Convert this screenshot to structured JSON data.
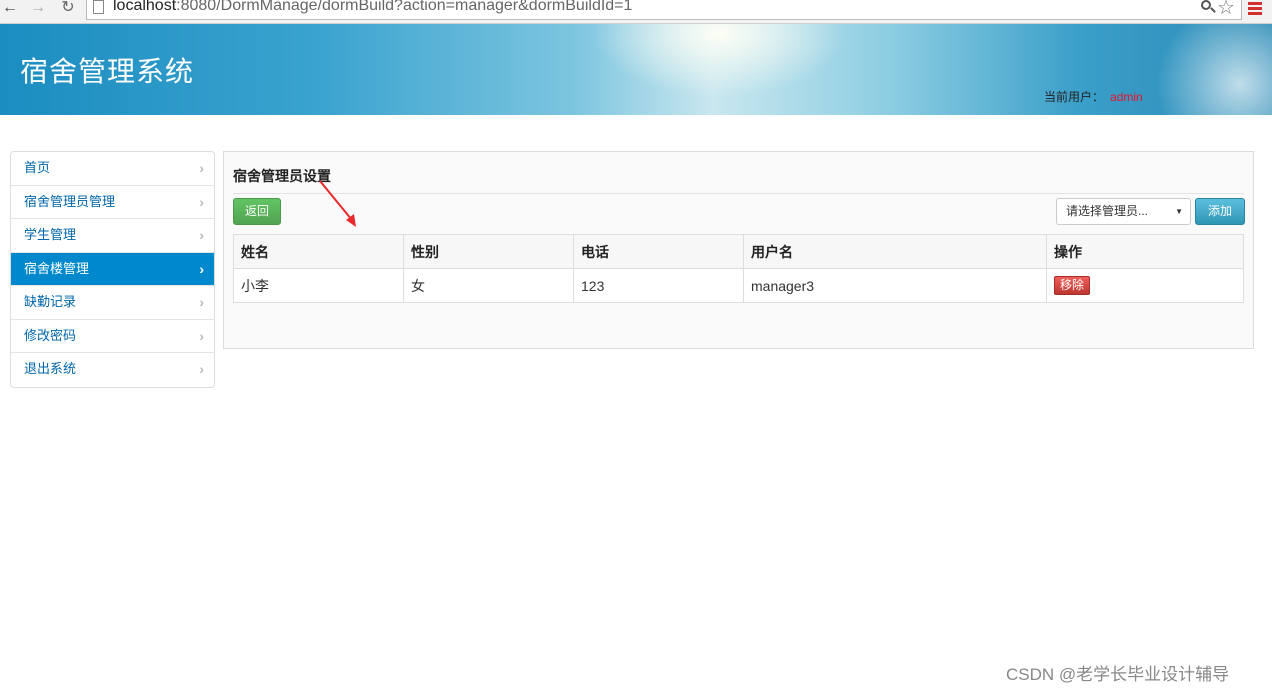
{
  "browser": {
    "url_host": "localhost",
    "url_rest": ":8080/DormManage/dormBuild?action=manager&dormBuildId=1"
  },
  "header": {
    "title": "宿舍管理系统",
    "user_label": "当前用户：",
    "user_name": "admin"
  },
  "sidebar": {
    "items": [
      {
        "label": "首页"
      },
      {
        "label": "宿舍管理员管理"
      },
      {
        "label": "学生管理"
      },
      {
        "label": "宿舍楼管理",
        "active": true
      },
      {
        "label": "缺勤记录"
      },
      {
        "label": "修改密码"
      },
      {
        "label": "退出系统"
      }
    ]
  },
  "main": {
    "title": "宿舍管理员设置",
    "back_label": "返回",
    "select_placeholder": "请选择管理员...",
    "add_label": "添加",
    "table": {
      "headers": [
        "姓名",
        "性别",
        "电话",
        "用户名",
        "操作"
      ],
      "rows": [
        {
          "name": "小李",
          "gender": "女",
          "phone": "123",
          "username": "manager3",
          "action": "移除"
        }
      ]
    }
  },
  "colors": {
    "accent": "#0088cc",
    "success": "#5cb85c",
    "info": "#49afcd",
    "danger": "#da4f49",
    "user_name": "#e8132b"
  },
  "icons": [
    "back-arrow-icon",
    "forward-arrow-icon",
    "reload-icon",
    "page-icon",
    "zoom-icon",
    "star-icon",
    "menu-icon",
    "chevron-right-icon"
  ],
  "watermark": "CSDN @老学长毕业设计辅导"
}
